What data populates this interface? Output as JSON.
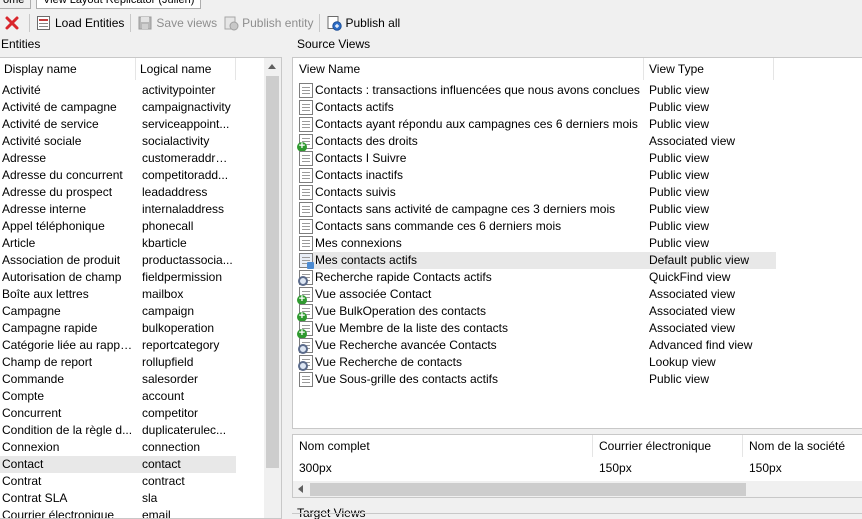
{
  "tabs": [
    {
      "label": "ome"
    },
    {
      "label": "View Layout Replicator (Julien)"
    }
  ],
  "toolbar": {
    "close_icon": "red-x-icon",
    "load_entities": "Load Entities",
    "save_views": "Save views",
    "publish_entity": "Publish entity",
    "publish_all": "Publish all"
  },
  "entities": {
    "label": "Entities",
    "columns": [
      "Display name",
      "Logical name"
    ],
    "rows": [
      [
        "Activité",
        "activitypointer"
      ],
      [
        "Activité de campagne",
        "campaignactivity"
      ],
      [
        "Activité de service",
        "serviceappoint..."
      ],
      [
        "Activité sociale",
        "socialactivity"
      ],
      [
        "Adresse",
        "customeraddress"
      ],
      [
        "Adresse du concurrent",
        "competitoradd..."
      ],
      [
        "Adresse du prospect",
        "leadaddress"
      ],
      [
        "Adresse interne",
        "internaladdress"
      ],
      [
        "Appel téléphonique",
        "phonecall"
      ],
      [
        "Article",
        "kbarticle"
      ],
      [
        "Association de produit",
        "productassocia..."
      ],
      [
        "Autorisation de champ",
        "fieldpermission"
      ],
      [
        "Boîte aux lettres",
        "mailbox"
      ],
      [
        "Campagne",
        "campaign"
      ],
      [
        "Campagne rapide",
        "bulkoperation"
      ],
      [
        "Catégorie liée au rapport",
        "reportcategory"
      ],
      [
        "Champ de report",
        "rollupfield"
      ],
      [
        "Commande",
        "salesorder"
      ],
      [
        "Compte",
        "account"
      ],
      [
        "Concurrent",
        "competitor"
      ],
      [
        "Condition de la règle d...",
        "duplicaterulec..."
      ],
      [
        "Connexion",
        "connection"
      ],
      [
        "Contact",
        "contact"
      ],
      [
        "Contrat",
        "contract"
      ],
      [
        "Contrat SLA",
        "sla"
      ],
      [
        "Courrier électronique",
        "email"
      ]
    ],
    "selected_index": 22
  },
  "source_views": {
    "label": "Source Views",
    "columns": [
      "View Name",
      "View Type"
    ],
    "rows": [
      {
        "name": "Contacts : transactions influencées que nous avons conclues",
        "type": "Public view",
        "icon": "view-icon"
      },
      {
        "name": "Contacts actifs",
        "type": "Public view",
        "icon": "view-icon"
      },
      {
        "name": "Contacts ayant répondu aux campagnes ces 6 derniers mois",
        "type": "Public view",
        "icon": "view-icon"
      },
      {
        "name": "Contacts des droits",
        "type": "Associated view",
        "icon": "associated-view-icon"
      },
      {
        "name": "Contacts I Suivre",
        "type": "Public view",
        "icon": "view-icon"
      },
      {
        "name": "Contacts inactifs",
        "type": "Public view",
        "icon": "view-icon"
      },
      {
        "name": "Contacts suivis",
        "type": "Public view",
        "icon": "view-icon"
      },
      {
        "name": "Contacts sans activité de campagne ces 3 derniers mois",
        "type": "Public view",
        "icon": "view-icon"
      },
      {
        "name": "Contacts sans commande ces 6 derniers mois",
        "type": "Public view",
        "icon": "view-icon"
      },
      {
        "name": "Mes connexions",
        "type": "Public view",
        "icon": "view-icon"
      },
      {
        "name": "Mes contacts actifs",
        "type": "Default public view",
        "icon": "default-view-icon"
      },
      {
        "name": "Recherche rapide Contacts actifs",
        "type": "QuickFind view",
        "icon": "quickfind-view-icon"
      },
      {
        "name": "Vue associée Contact",
        "type": "Associated view",
        "icon": "associated-view-icon"
      },
      {
        "name": "Vue BulkOperation des contacts",
        "type": "Associated view",
        "icon": "associated-view-icon"
      },
      {
        "name": "Vue Membre de la liste des contacts",
        "type": "Associated view",
        "icon": "associated-view-icon"
      },
      {
        "name": "Vue Recherche avancée Contacts",
        "type": "Advanced find view",
        "icon": "advanced-find-view-icon"
      },
      {
        "name": "Vue Recherche de contacts",
        "type": "Lookup view",
        "icon": "lookup-view-icon"
      },
      {
        "name": "Vue Sous-grille des contacts actifs",
        "type": "Public view",
        "icon": "view-icon"
      }
    ],
    "selected_index": 10
  },
  "layout_preview": {
    "columns": [
      "Nom complet",
      "Courrier électronique",
      "Nom de la société"
    ],
    "values": [
      "300px",
      "150px",
      "150px"
    ]
  },
  "target_views": {
    "label": "Target Views"
  }
}
